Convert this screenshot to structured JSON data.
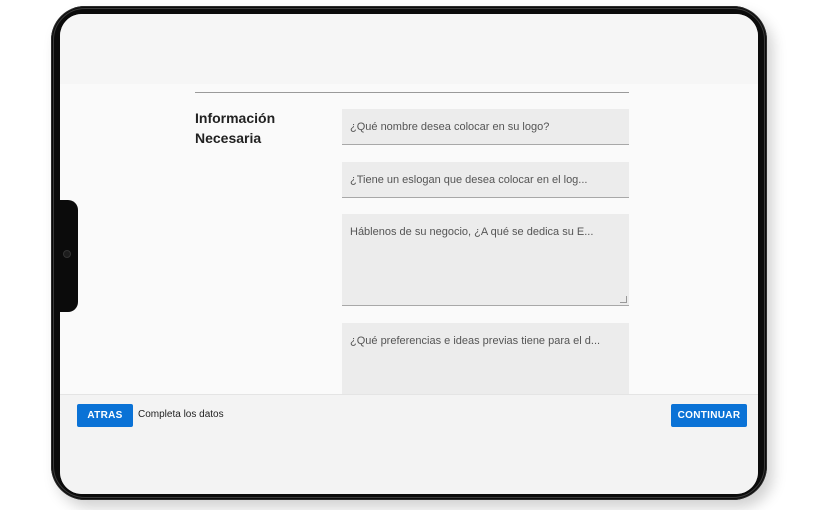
{
  "form": {
    "section_title": "Información Necesaria",
    "fields": [
      {
        "placeholder": "¿Qué nombre desea colocar en su logo?"
      },
      {
        "placeholder": "¿Tiene un eslogan que desea colocar en el log..."
      },
      {
        "placeholder": "Háblenos de su negocio, ¿A qué se dedica su E..."
      },
      {
        "placeholder": "¿Qué preferencias e ideas previas tiene para el d..."
      }
    ]
  },
  "footer": {
    "back_label": "ATRAS",
    "status_text": "Completa los datos",
    "continue_label": "CONTINUAR"
  },
  "colors": {
    "primary_button": "#0a72d6",
    "field_background": "#ececec"
  }
}
